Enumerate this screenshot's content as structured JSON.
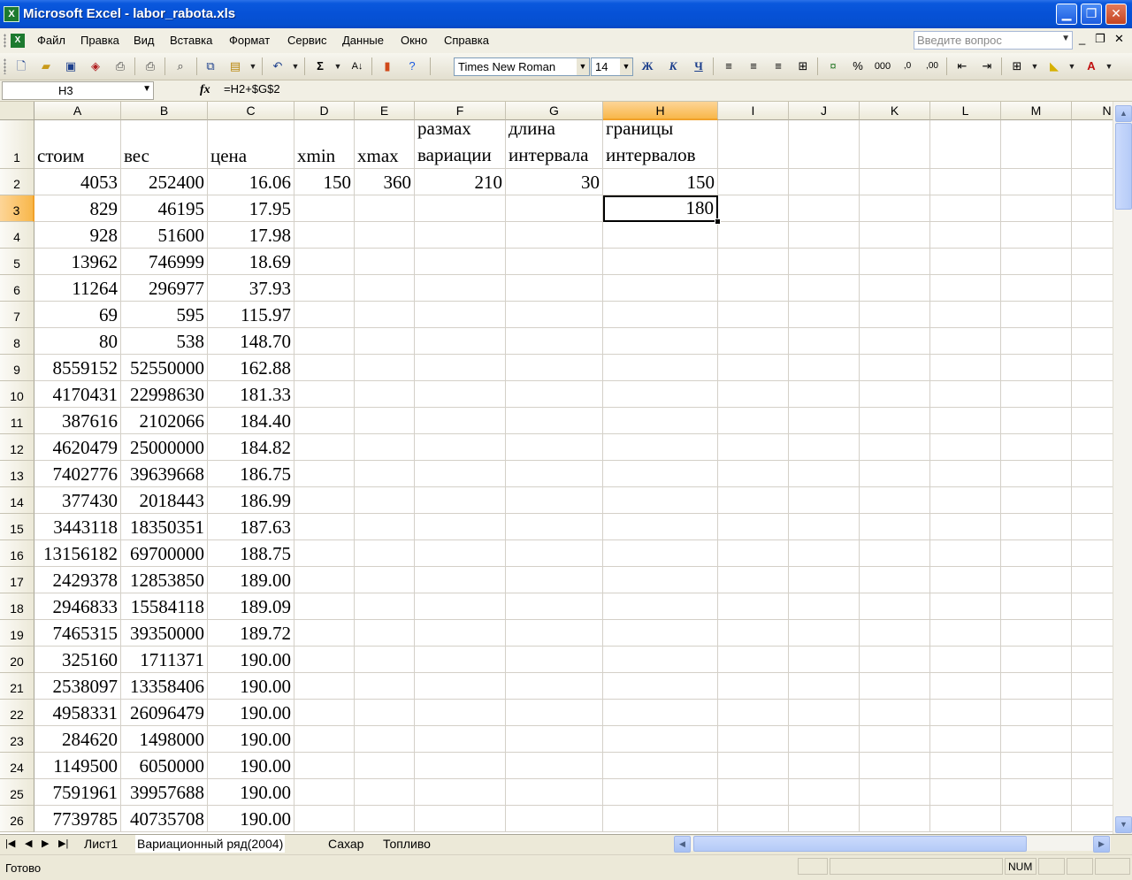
{
  "window": {
    "title": "Microsoft Excel - labor_rabota.xls",
    "minimize": "▁",
    "maximize": "❐",
    "close": "✕"
  },
  "menu": {
    "items": [
      "Файл",
      "Правка",
      "Вид",
      "Вставка",
      "Формат",
      "Сервис",
      "Данные",
      "Окно",
      "Справка"
    ],
    "help_placeholder": "Введите вопрос"
  },
  "toolbar": {
    "font_name": "Times New Roman",
    "font_size": "14",
    "bold": "Ж",
    "italic": "К",
    "underline": "Ч",
    "sum": "Σ",
    "percent": "%",
    "thousands": "000"
  },
  "formula_bar": {
    "name_box": "H3",
    "fx": "fx",
    "formula": "=H2+$G$2"
  },
  "grid": {
    "columns": [
      "A",
      "B",
      "C",
      "D",
      "E",
      "F",
      "G",
      "H",
      "I",
      "J",
      "K",
      "L",
      "M",
      "N"
    ],
    "selected_column": "H",
    "selected_row": "3",
    "active_cell": "H3",
    "headers_row1": {
      "A": "стоим",
      "B": "вес",
      "C": "цена",
      "D": "xmin",
      "E": "xmax",
      "F": "размах\nвариации",
      "G": "длина\nинтервала",
      "H": "границы\nинтервалов"
    },
    "row2_extra": {
      "D": "150",
      "E": "360",
      "F": "210",
      "G": "30",
      "H": "150"
    },
    "row3_extra": {
      "H": "180"
    },
    "rows": [
      {
        "n": "2",
        "A": "4053",
        "B": "252400",
        "C": "16.06"
      },
      {
        "n": "3",
        "A": "829",
        "B": "46195",
        "C": "17.95"
      },
      {
        "n": "4",
        "A": "928",
        "B": "51600",
        "C": "17.98"
      },
      {
        "n": "5",
        "A": "13962",
        "B": "746999",
        "C": "18.69"
      },
      {
        "n": "6",
        "A": "11264",
        "B": "296977",
        "C": "37.93"
      },
      {
        "n": "7",
        "A": "69",
        "B": "595",
        "C": "115.97"
      },
      {
        "n": "8",
        "A": "80",
        "B": "538",
        "C": "148.70"
      },
      {
        "n": "9",
        "A": "8559152",
        "B": "52550000",
        "C": "162.88"
      },
      {
        "n": "10",
        "A": "4170431",
        "B": "22998630",
        "C": "181.33"
      },
      {
        "n": "11",
        "A": "387616",
        "B": "2102066",
        "C": "184.40"
      },
      {
        "n": "12",
        "A": "4620479",
        "B": "25000000",
        "C": "184.82"
      },
      {
        "n": "13",
        "A": "7402776",
        "B": "39639668",
        "C": "186.75"
      },
      {
        "n": "14",
        "A": "377430",
        "B": "2018443",
        "C": "186.99"
      },
      {
        "n": "15",
        "A": "3443118",
        "B": "18350351",
        "C": "187.63"
      },
      {
        "n": "16",
        "A": "13156182",
        "B": "69700000",
        "C": "188.75"
      },
      {
        "n": "17",
        "A": "2429378",
        "B": "12853850",
        "C": "189.00"
      },
      {
        "n": "18",
        "A": "2946833",
        "B": "15584118",
        "C": "189.09"
      },
      {
        "n": "19",
        "A": "7465315",
        "B": "39350000",
        "C": "189.72"
      },
      {
        "n": "20",
        "A": "325160",
        "B": "1711371",
        "C": "190.00"
      },
      {
        "n": "21",
        "A": "2538097",
        "B": "13358406",
        "C": "190.00"
      },
      {
        "n": "22",
        "A": "4958331",
        "B": "26096479",
        "C": "190.00"
      },
      {
        "n": "23",
        "A": "284620",
        "B": "1498000",
        "C": "190.00"
      },
      {
        "n": "24",
        "A": "1149500",
        "B": "6050000",
        "C": "190.00"
      },
      {
        "n": "25",
        "A": "7591961",
        "B": "39957688",
        "C": "190.00"
      },
      {
        "n": "26",
        "A": "7739785",
        "B": "40735708",
        "C": "190.00"
      }
    ]
  },
  "sheet_tabs": {
    "tabs": [
      "Лист1",
      "Вариационный ряд(2004)",
      "Сахар",
      "Топливо"
    ],
    "active": "Вариационный ряд(2004)"
  },
  "status": {
    "ready": "Готово",
    "num": "NUM"
  },
  "colors": {
    "titlebar": "#0651d6",
    "selected_header": "#f8b74a",
    "chrome": "#ece9d8"
  }
}
